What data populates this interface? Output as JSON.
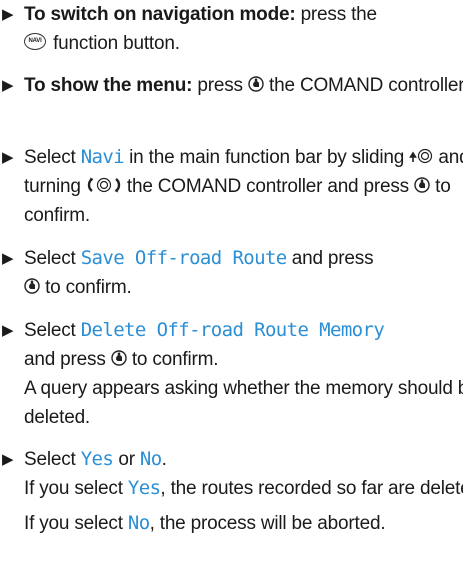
{
  "steps": [
    {
      "lead_bold": "To switch on navigation mode:",
      "text_a": "press the",
      "navi_button": "NAVI",
      "text_b": "function button."
    },
    {
      "lead_bold": "To show the menu:",
      "text_a": "press",
      "text_b": "the COMAND controller."
    },
    {
      "text_a": "Select",
      "option": "Navi",
      "text_b": "in the main function bar by sliding",
      "text_c": "and turning",
      "text_d": "the COMAND controller and press",
      "text_e": "to confirm."
    },
    {
      "text_a": "Select",
      "option": "Save Off-road Route",
      "text_b": "and press",
      "text_c": "to confirm."
    },
    {
      "text_a": "Select",
      "option": "Delete Off-road Route Memory",
      "text_b": "and press",
      "text_c": "to confirm.",
      "result": "A query appears asking whether the memory should be deleted."
    },
    {
      "text_a": "Select",
      "option_yes": "Yes",
      "text_or": "or",
      "option_no": "No",
      "text_dot": ".",
      "if_yes_a": "If you select",
      "if_yes_option": "Yes",
      "if_yes_b": ", the routes recorded so far are deleted.",
      "if_no_a": "If you select",
      "if_no_option": "No",
      "if_no_b": ", the process will be aborted."
    }
  ]
}
